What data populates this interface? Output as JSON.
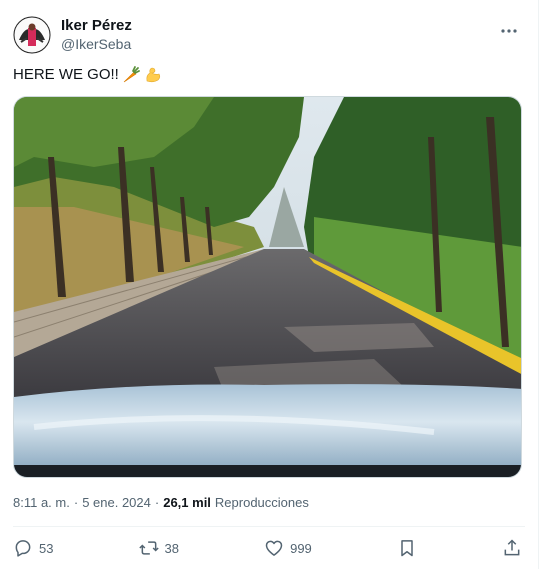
{
  "author": {
    "display_name": "Iker Pérez",
    "handle": "@IkerSeba",
    "avatar_icon": "avatar-photo"
  },
  "tweet": {
    "text": "HERE WE GO!!",
    "emojis": [
      "carrot-emoji",
      "flexed-biceps-emoji"
    ]
  },
  "media": {
    "description_icon": "photo-tree-lined-road"
  },
  "meta": {
    "time": "8:11 a. m.",
    "separator": "·",
    "date": "5 ene. 2024",
    "views_count": "26,1 mil",
    "views_label": "Reproducciones"
  },
  "actions": {
    "replies": "53",
    "reposts": "38",
    "likes": "999"
  },
  "colors": {
    "text_primary": "#0f1419",
    "text_secondary": "#536471",
    "border": "#eff3f4"
  }
}
